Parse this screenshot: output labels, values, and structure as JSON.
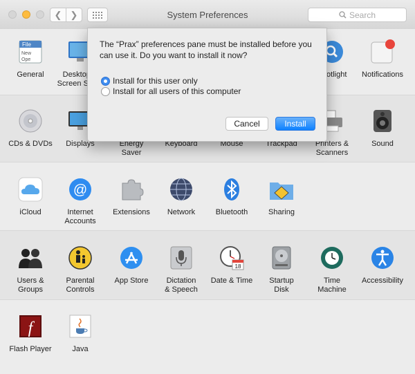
{
  "window": {
    "title": "System Preferences",
    "search_placeholder": "Search"
  },
  "colors": {
    "accent": "#3f8df0",
    "install_button": "#1a8aff"
  },
  "rows": [
    [
      {
        "id": "general",
        "label": "General",
        "icon": "general-icon",
        "icon_text": "File\nNew\nOpe"
      },
      {
        "id": "desktop",
        "label": "Desktop &\nScreen Saver",
        "icon": "desktop-icon"
      },
      {
        "id": "spotlight",
        "label": "Spotlight",
        "icon": "spotlight-icon"
      },
      {
        "id": "notifications",
        "label": "Notifications",
        "icon": "notifications-icon"
      }
    ],
    [
      {
        "id": "cds",
        "label": "CDs & DVDs",
        "icon": "cd-icon"
      },
      {
        "id": "displays",
        "label": "Displays",
        "icon": "displays-icon"
      },
      {
        "id": "energy",
        "label": "Energy\nSaver",
        "icon": "energy-icon"
      },
      {
        "id": "keyboard",
        "label": "Keyboard",
        "icon": "keyboard-icon"
      },
      {
        "id": "mouse",
        "label": "Mouse",
        "icon": "mouse-icon"
      },
      {
        "id": "trackpad",
        "label": "Trackpad",
        "icon": "trackpad-icon"
      },
      {
        "id": "printers",
        "label": "Printers &\nScanners",
        "icon": "printer-icon"
      },
      {
        "id": "sound",
        "label": "Sound",
        "icon": "speaker-icon"
      }
    ],
    [
      {
        "id": "icloud",
        "label": "iCloud",
        "icon": "icloud-icon"
      },
      {
        "id": "internet",
        "label": "Internet\nAccounts",
        "icon": "at-icon"
      },
      {
        "id": "extensions",
        "label": "Extensions",
        "icon": "puzzle-icon"
      },
      {
        "id": "network",
        "label": "Network",
        "icon": "globe-icon"
      },
      {
        "id": "bluetooth",
        "label": "Bluetooth",
        "icon": "bluetooth-icon"
      },
      {
        "id": "sharing",
        "label": "Sharing",
        "icon": "sharing-folder-icon"
      }
    ],
    [
      {
        "id": "users",
        "label": "Users &\nGroups",
        "icon": "users-icon"
      },
      {
        "id": "parental",
        "label": "Parental\nControls",
        "icon": "parental-icon"
      },
      {
        "id": "appstore",
        "label": "App Store",
        "icon": "appstore-icon"
      },
      {
        "id": "dictation",
        "label": "Dictation\n& Speech",
        "icon": "microphone-icon"
      },
      {
        "id": "datetime",
        "label": "Date & Time",
        "icon": "clock-icon",
        "icon_text": "18"
      },
      {
        "id": "startup",
        "label": "Startup\nDisk",
        "icon": "disk-icon"
      },
      {
        "id": "timemachine",
        "label": "Time\nMachine",
        "icon": "timemachine-icon"
      },
      {
        "id": "accessibility",
        "label": "Accessibility",
        "icon": "accessibility-icon"
      }
    ],
    [
      {
        "id": "flash",
        "label": "Flash Player",
        "icon": "flash-icon",
        "icon_text": "f"
      },
      {
        "id": "java",
        "label": "Java",
        "icon": "java-icon"
      }
    ]
  ],
  "dialog": {
    "message": "The “Prax” preferences pane must be installed before you can use it. Do you want to install it now?",
    "options": [
      {
        "label": "Install for this user only",
        "selected": true
      },
      {
        "label": "Install for all users of this computer",
        "selected": false
      }
    ],
    "cancel_label": "Cancel",
    "install_label": "Install"
  }
}
